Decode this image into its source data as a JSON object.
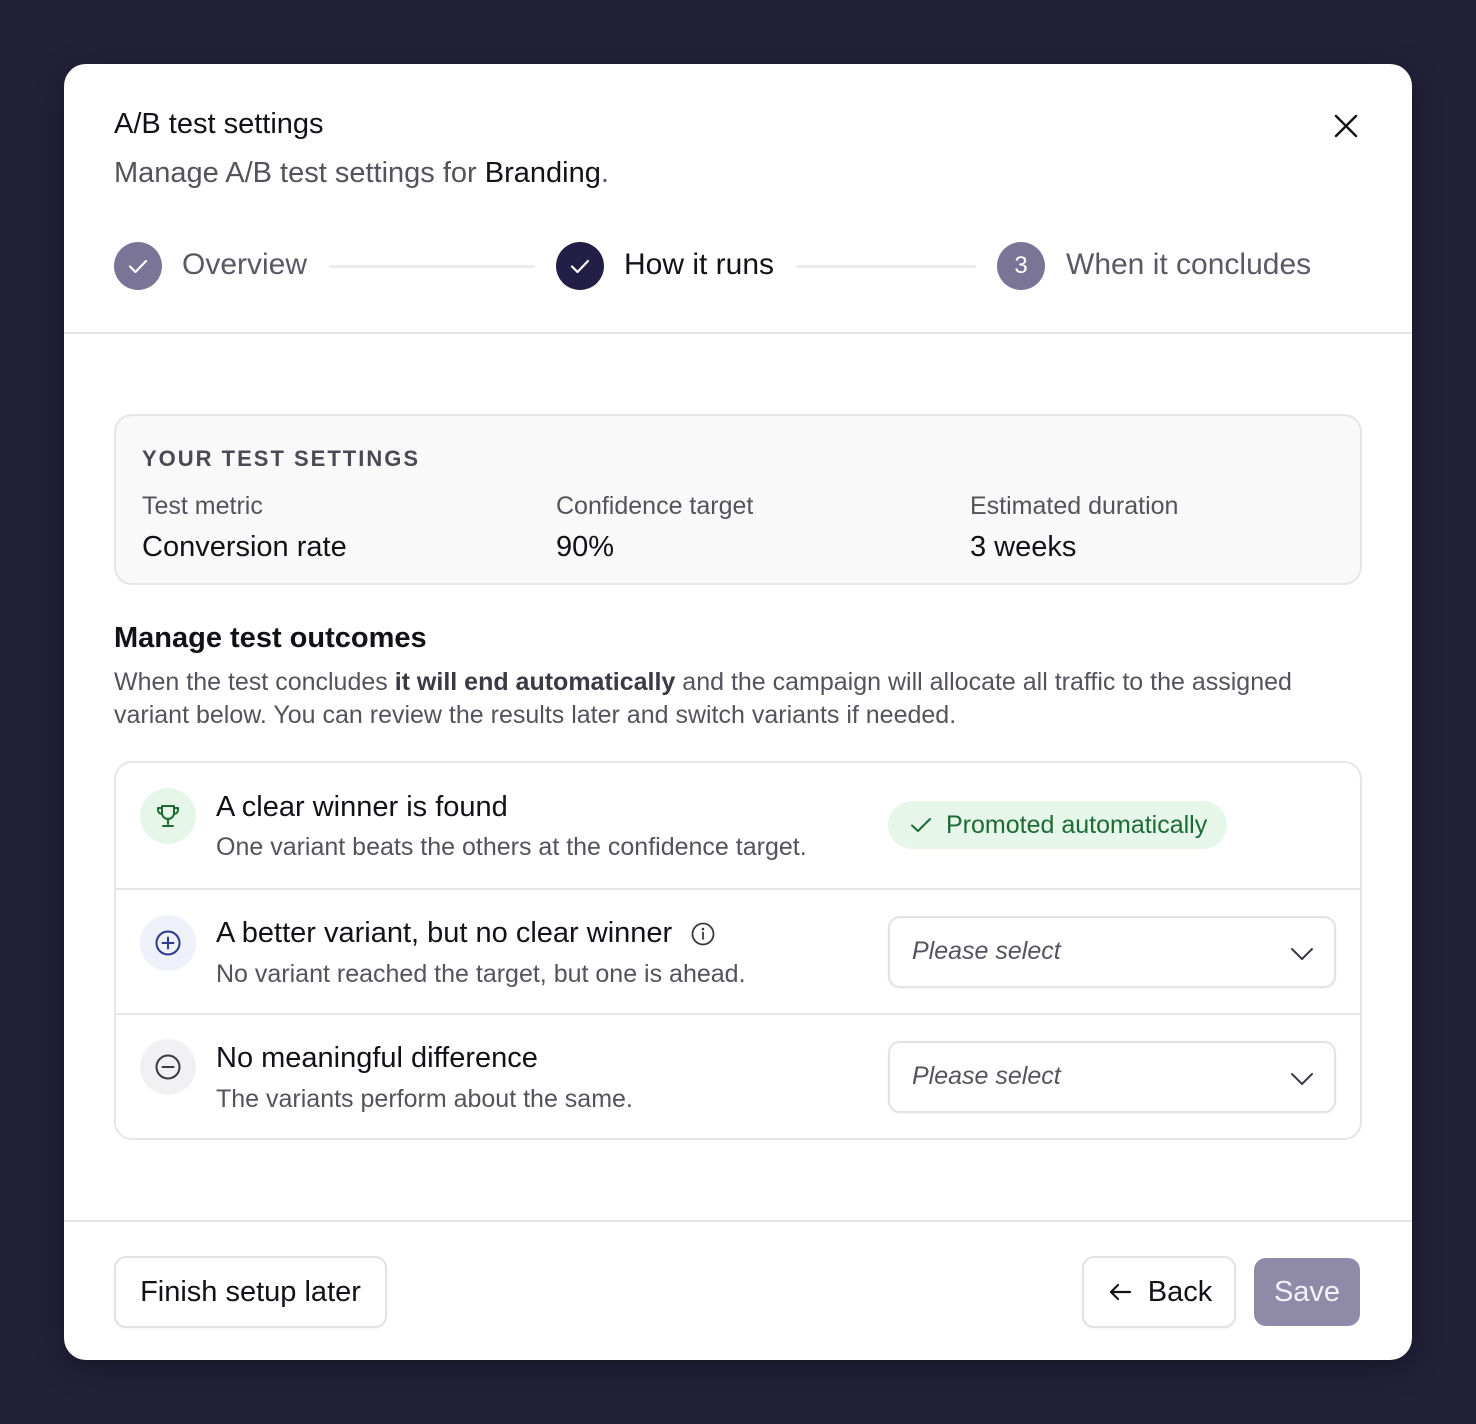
{
  "modal": {
    "title": "A/B test settings",
    "subtitle_prefix": "Manage A/B test settings for ",
    "subtitle_target": "Branding",
    "subtitle_suffix": ".",
    "close_icon": "close-icon"
  },
  "stepper": {
    "steps": [
      {
        "label": "Overview",
        "state": "completed",
        "indicator": "check-icon"
      },
      {
        "label": "How it runs",
        "state": "current",
        "indicator": "check-icon"
      },
      {
        "label": "When it concludes",
        "state": "upcoming",
        "indicator": "3"
      }
    ]
  },
  "summary": {
    "title": "YOUR TEST SETTINGS",
    "metrics": [
      {
        "label": "Test metric",
        "value": "Conversion rate"
      },
      {
        "label": "Confidence target",
        "value": "90%"
      },
      {
        "label": "Estimated duration",
        "value": "3 weeks"
      }
    ]
  },
  "outcomes": {
    "title": "Manage test outcomes",
    "desc_part1": "When the test concludes ",
    "desc_bold": "it will end automatically",
    "desc_part2": " and the campaign will allocate all traffic to the assigned variant below. You can review the results later and switch variants if needed.",
    "rows": [
      {
        "icon": "trophy-icon",
        "title": "A clear winner is found",
        "description": "One variant beats the others at the confidence target.",
        "badge": "Promoted automatically"
      },
      {
        "icon": "plus-circle-icon",
        "title": "A better variant, but no clear winner",
        "description": "No variant reached the target, but one is ahead.",
        "select_placeholder": "Please select"
      },
      {
        "icon": "minus-circle-icon",
        "title": "No meaningful difference",
        "description": "The variants perform about the same.",
        "select_placeholder": "Please select"
      }
    ]
  },
  "footer": {
    "finish_later": "Finish setup later",
    "back": "Back",
    "save": "Save"
  },
  "colors": {
    "primary_dark": "#221e45",
    "completed_step": "#7a7596",
    "success_bg": "#e6f7ea",
    "success_text": "#1c6a34",
    "save_disabled": "#8e8aa8"
  }
}
